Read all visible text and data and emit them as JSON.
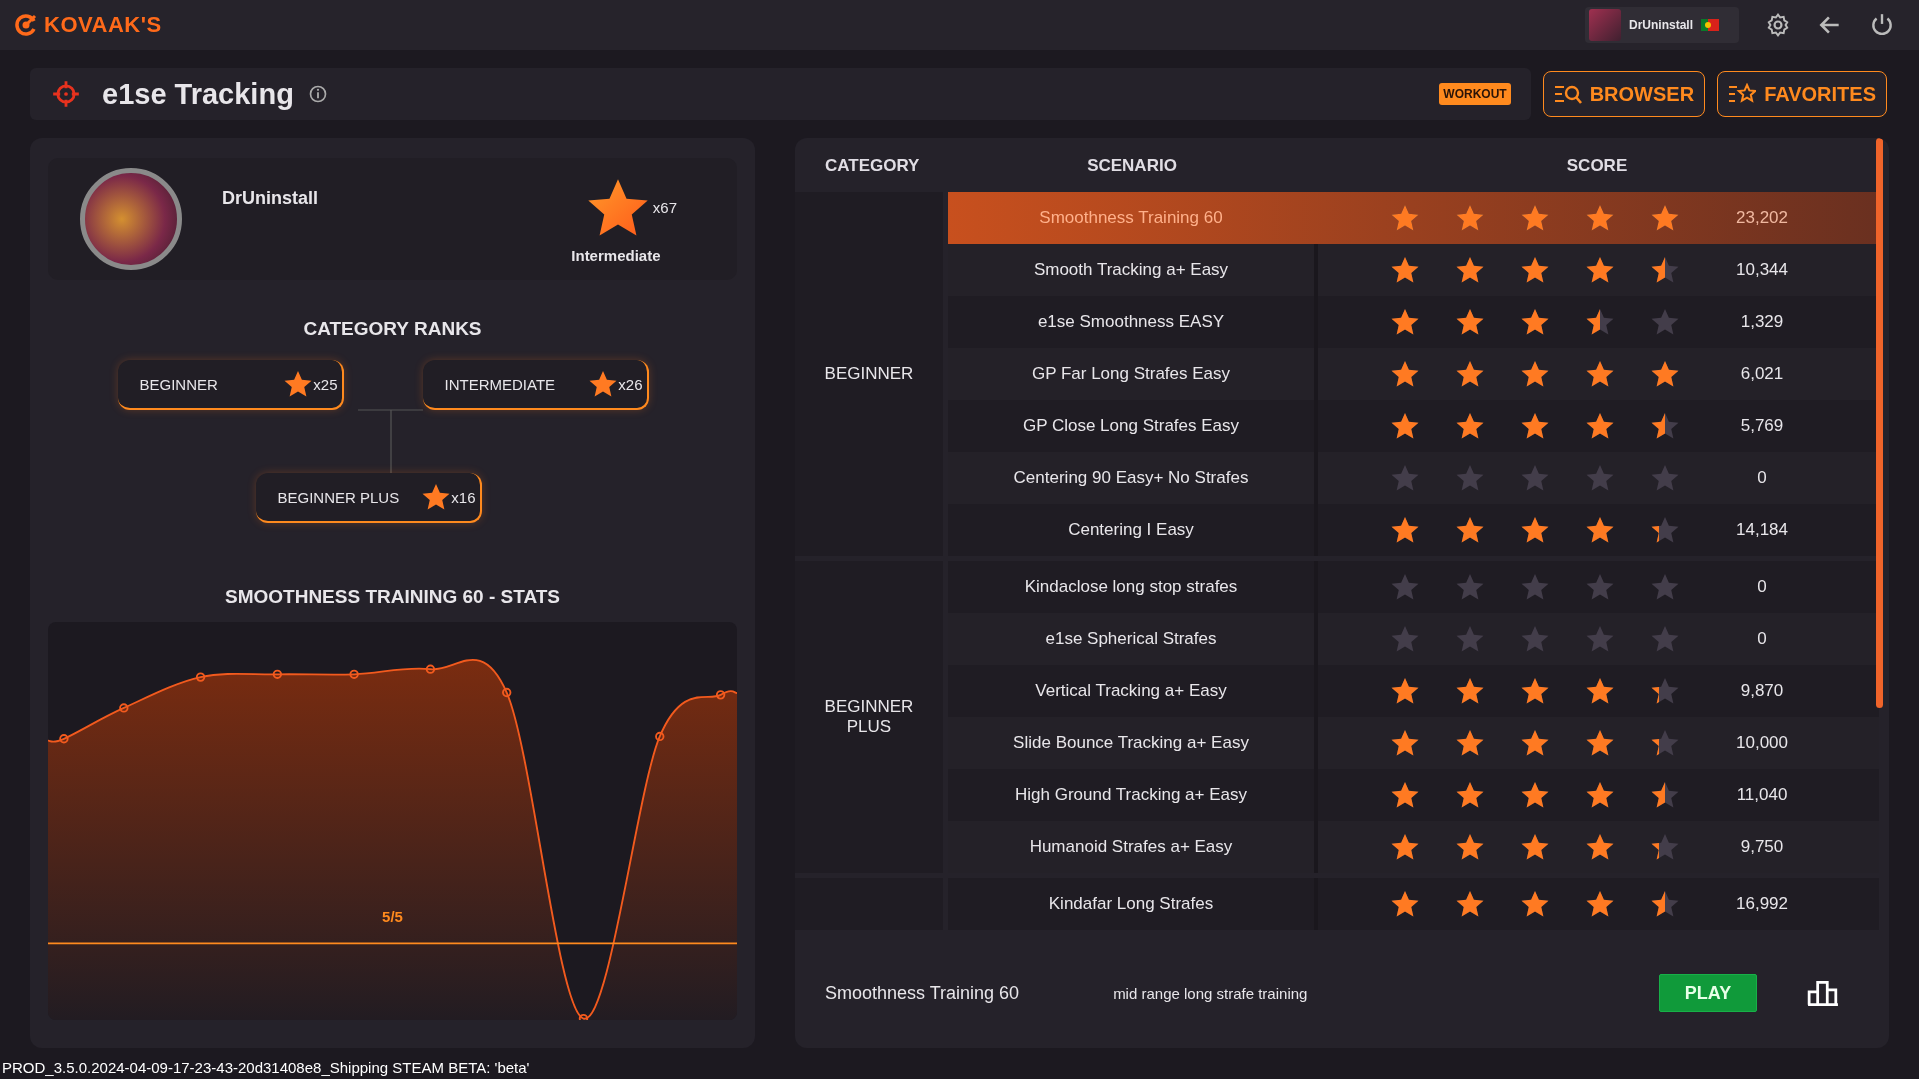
{
  "app": {
    "logo": "KOVAAK'S"
  },
  "user_chip": {
    "name": "DrUninstall"
  },
  "header": {
    "title": "e1se Tracking",
    "badge": "WORKOUT",
    "buttons": [
      {
        "label": "BROWSER",
        "kind": "browser"
      },
      {
        "label": "FAVORITES",
        "kind": "favorites"
      }
    ]
  },
  "profile": {
    "name": "DrUninstall",
    "star_count": "x67",
    "rank": "Intermediate"
  },
  "category_ranks": {
    "title": "CATEGORY RANKS",
    "ranks": [
      {
        "label": "BEGINNER",
        "count": "x25"
      },
      {
        "label": "INTERMEDIATE",
        "count": "x26"
      },
      {
        "label": "BEGINNER PLUS",
        "count": "x16"
      }
    ]
  },
  "stats": {
    "title": "SMOOTHNESS TRAINING 60 - STATS",
    "threshold_label": "5/5"
  },
  "table": {
    "columns": [
      "CATEGORY",
      "SCENARIO",
      "SCORE"
    ],
    "categories": [
      {
        "name": "BEGINNER",
        "scenarios": [
          {
            "name": "Smoothness Training 60",
            "stars": 5,
            "score": "23,202",
            "selected": true
          },
          {
            "name": "Smooth Tracking a+ Easy",
            "stars": 4.5,
            "score": "10,344",
            "selected": false
          },
          {
            "name": "e1se Smoothness EASY",
            "stars": 3.5,
            "score": "1,329",
            "selected": false
          },
          {
            "name": "GP Far Long Strafes Easy",
            "stars": 5,
            "score": "6,021",
            "selected": false
          },
          {
            "name": "GP Close Long Strafes Easy",
            "stars": 4.5,
            "score": "5,769",
            "selected": false
          },
          {
            "name": "Centering 90 Easy+ No Strafes",
            "stars": 0,
            "score": "0",
            "selected": false
          },
          {
            "name": "Centering I Easy",
            "stars": 4.3,
            "score": "14,184",
            "selected": false
          }
        ]
      },
      {
        "name": "BEGINNER PLUS",
        "scenarios": [
          {
            "name": "Kindaclose long stop strafes",
            "stars": 0,
            "score": "0",
            "selected": false
          },
          {
            "name": "e1se Spherical Strafes",
            "stars": 0,
            "score": "0",
            "selected": false
          },
          {
            "name": "Vertical Tracking a+ Easy",
            "stars": 4.3,
            "score": "9,870",
            "selected": false
          },
          {
            "name": "Slide Bounce Tracking a+ Easy",
            "stars": 4.3,
            "score": "10,000",
            "selected": false
          },
          {
            "name": "High Ground Tracking a+ Easy",
            "stars": 4.5,
            "score": "11,040",
            "selected": false
          },
          {
            "name": "Humanoid Strafes a+ Easy",
            "stars": 4.3,
            "score": "9,750",
            "selected": false
          }
        ]
      },
      {
        "scenarios": [
          {
            "name": "Kindafar Long Strafes",
            "stars": 4.5,
            "score": "16,992",
            "selected": false
          }
        ]
      }
    ]
  },
  "footer": {
    "scenario": "Smoothness Training 60",
    "description": "mid range long strafe training",
    "play": "PLAY"
  },
  "status_bar": "PROD_3.5.0.2024-04-09-17-23-43-20d31408e8_Shipping STEAM BETA: 'beta'"
}
